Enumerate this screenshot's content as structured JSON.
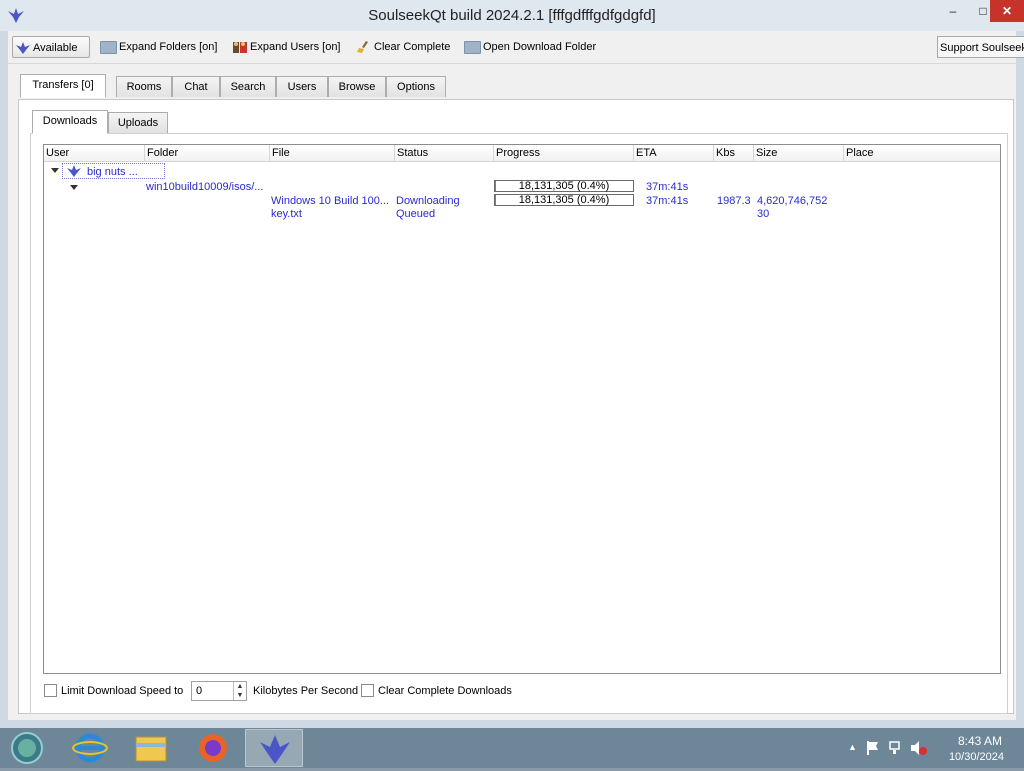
{
  "window": {
    "title": "SoulseekQt build 2024.2.1 [fffgdfffgdfgdgfd]"
  },
  "toolbar": {
    "available": "Available",
    "expand_folders": "Expand Folders [on]",
    "expand_users": "Expand Users [on]",
    "clear_complete": "Clear Complete",
    "open_download_folder": "Open Download Folder",
    "support": "Support Soulseek"
  },
  "tabs": [
    "Transfers [0]",
    "Rooms",
    "Chat",
    "Search",
    "Users",
    "Browse",
    "Options"
  ],
  "subtabs": [
    "Downloads",
    "Uploads"
  ],
  "columns": [
    "User",
    "Folder",
    "File",
    "Status",
    "Progress",
    "ETA",
    "Kbs",
    "Size",
    "Place"
  ],
  "rows": {
    "user": "big nuts ...",
    "folder": {
      "name": "win10build10009/isos/...",
      "progress_label": "18,131,305 (0.4%)",
      "progress_fraction": 0.004,
      "eta": "37m:41s"
    },
    "files": [
      {
        "file": "Windows 10 Build 100...",
        "status": "Downloading",
        "progress_label": "18,131,305 (0.4%)",
        "progress_fraction": 0.004,
        "eta": "37m:41s",
        "kbs": "1987.3",
        "size": "4,620,746,752",
        "place": ""
      },
      {
        "file": "key.txt",
        "status": "Queued",
        "progress_label": "",
        "eta": "",
        "kbs": "",
        "size": "30",
        "place": ""
      }
    ]
  },
  "bottom": {
    "limit_speed_label": "Limit Download Speed to",
    "limit_speed_value": "0",
    "unit_label": "Kilobytes Per Second",
    "clear_complete_label": "Clear Complete Downloads"
  },
  "taskbar": {
    "time": "8:43 AM",
    "date": "10/30/2024"
  },
  "colors": {
    "accent_text": "#2a2ad0",
    "close_button": "#c7332b",
    "taskbar": "#6d8798"
  }
}
